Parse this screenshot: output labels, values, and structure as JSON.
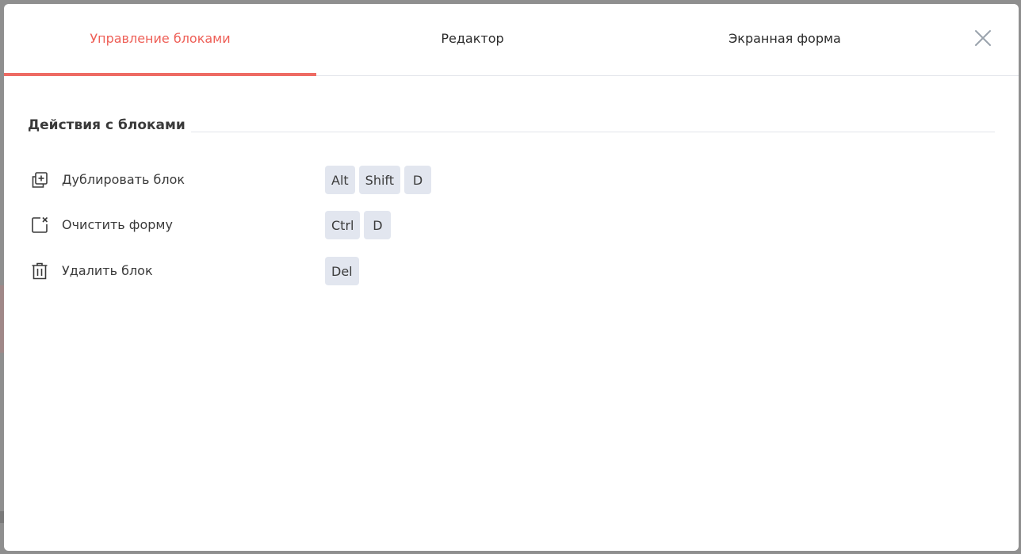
{
  "tabs": [
    {
      "label": "Управление блоками",
      "active": true
    },
    {
      "label": "Редактор",
      "active": false
    },
    {
      "label": "Экранная форма",
      "active": false
    }
  ],
  "section": {
    "title": "Действия с блоками"
  },
  "actions": [
    {
      "label": "Дублировать блок",
      "icon": "duplicate-icon",
      "keys": [
        "Alt",
        "Shift",
        "D"
      ]
    },
    {
      "label": "Очистить форму",
      "icon": "clear-form-icon",
      "keys": [
        "Ctrl",
        "D"
      ]
    },
    {
      "label": "Удалить блок",
      "icon": "trash-icon",
      "keys": [
        "Del"
      ]
    }
  ],
  "colors": {
    "accent": "#ee5f57",
    "key_bg": "#e2e6ef"
  }
}
